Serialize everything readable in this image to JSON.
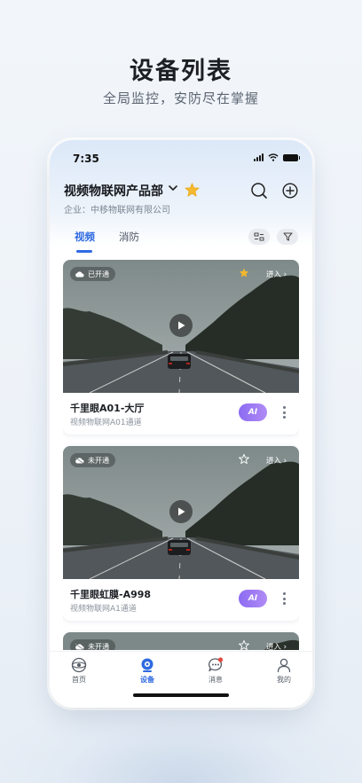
{
  "promo": {
    "title": "设备列表",
    "subtitle": "全局监控，安防尽在掌握"
  },
  "status_bar": {
    "time": "7:35"
  },
  "header": {
    "org_name": "视频物联网产品部",
    "company_label": "企业：中移物联网有限公司",
    "icons": [
      "chevron-down-icon",
      "star-icon",
      "search-icon",
      "add-circle-icon"
    ],
    "star_color": "#f5b82e"
  },
  "tabs": [
    {
      "label": "视频",
      "active": true
    },
    {
      "label": "消防",
      "active": false
    }
  ],
  "toolbar": {
    "icons": [
      "scan-icon",
      "filter-icon"
    ]
  },
  "devices": [
    {
      "status": "已开通",
      "enter": "进入",
      "starred": true,
      "title": "千里眼A01-大厅",
      "channel": "视频物联网A01通道",
      "ai_label": "AI"
    },
    {
      "status": "未开通",
      "enter": "进入",
      "starred": false,
      "title": "千里眼虹膜-A998",
      "channel": "视频物联网A1通道",
      "ai_label": "AI"
    },
    {
      "status": "未开通",
      "enter": "进入",
      "starred": false
    }
  ],
  "bottom_nav": [
    {
      "label": "首页",
      "icon": "home-icon",
      "active": false
    },
    {
      "label": "设备",
      "icon": "camera-icon",
      "active": true
    },
    {
      "label": "消息",
      "icon": "message-icon",
      "active": false,
      "badge": true
    },
    {
      "label": "我的",
      "icon": "user-icon",
      "active": false
    }
  ],
  "colors": {
    "accent": "#2f6ae0",
    "ai_gradient_start": "#8c6bf2",
    "ai_gradient_end": "#b08cf5",
    "badge": "#e5483f"
  }
}
